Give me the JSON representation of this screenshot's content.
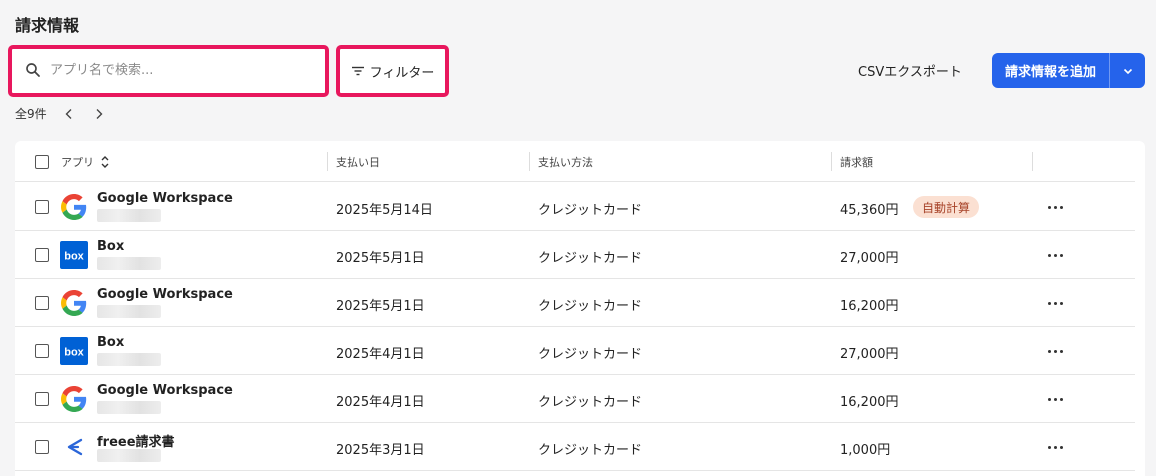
{
  "page": {
    "title": "請求情報"
  },
  "toolbar": {
    "search_placeholder": "アプリ名で検索...",
    "filter_label": "フィルター",
    "csv_export_label": "CSVエクスポート",
    "add_button_label": "請求情報を追加",
    "highlight_color": "#e8175d",
    "primary_color": "#2563eb"
  },
  "pager": {
    "total_label": "全9件"
  },
  "table": {
    "headers": {
      "app": "アプリ",
      "date": "支払い日",
      "method": "支払い方法",
      "amount": "請求額"
    },
    "rows": [
      {
        "app": "Google Workspace",
        "logo": "google-logo",
        "date": "2025年5月14日",
        "method": "クレジットカード",
        "amount": "45,360円",
        "badge": "自動計算"
      },
      {
        "app": "Box",
        "logo": "box-logo",
        "date": "2025年5月1日",
        "method": "クレジットカード",
        "amount": "27,000円",
        "badge": ""
      },
      {
        "app": "Google Workspace",
        "logo": "google-logo",
        "date": "2025年5月1日",
        "method": "クレジットカード",
        "amount": "16,200円",
        "badge": ""
      },
      {
        "app": "Box",
        "logo": "box-logo",
        "date": "2025年4月1日",
        "method": "クレジットカード",
        "amount": "27,000円",
        "badge": ""
      },
      {
        "app": "Google Workspace",
        "logo": "google-logo",
        "date": "2025年4月1日",
        "method": "クレジットカード",
        "amount": "16,200円",
        "badge": ""
      },
      {
        "app": "freee請求書",
        "logo": "freee-logo",
        "date": "2025年3月1日",
        "method": "クレジットカード",
        "amount": "1,000円",
        "badge": ""
      }
    ]
  }
}
